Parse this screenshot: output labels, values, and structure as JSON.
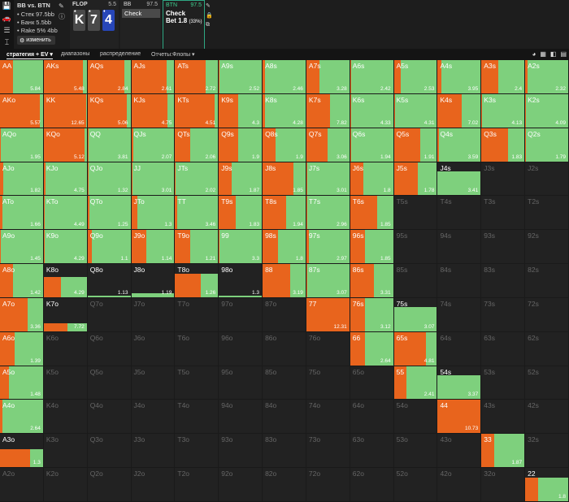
{
  "colors": {
    "check": "#7ed07d",
    "bet": "#e8641d",
    "empty": "#222222",
    "accent": "#2ea883"
  },
  "sidebar_icons": [
    "save-icon",
    "car-icon",
    "layers-icon",
    "cursor-icon"
  ],
  "info": {
    "matchup": "BB vs. BTN",
    "stack": "• Стек 97.5bb",
    "bank": "• Банк 5.5bb",
    "rake": "• Rake 5% 4bb",
    "edit_label": "изменить"
  },
  "flop": {
    "label": "FLOP",
    "pot": "5.5",
    "cards": [
      {
        "rank": "K",
        "suit": "♠",
        "color": "#4a4a4a"
      },
      {
        "rank": "7",
        "suit": "♠",
        "color": "#4a4a4a"
      },
      {
        "rank": "4",
        "suit": "♦",
        "color": "#2746b8"
      }
    ]
  },
  "bb": {
    "label": "BB",
    "pot": "97.5",
    "action": "Check"
  },
  "btn": {
    "label": "BTN",
    "pot": "97.5",
    "action1": "Check",
    "action2": "Bet 1.8",
    "action2_pct": "(33%)"
  },
  "tabs": [
    {
      "label": "стратегия + EV",
      "active": true,
      "caret": true
    },
    {
      "label": "диапазоны",
      "active": false,
      "caret": false
    },
    {
      "label": "распределение",
      "active": false,
      "caret": false
    },
    {
      "label": "Отчеты:Флопы",
      "active": false,
      "caret": true
    }
  ],
  "grid": {
    "rows": [
      [
        [
          "AA",
          0.3,
          "5.84"
        ],
        [
          "AKs",
          0.92,
          "5.48"
        ],
        [
          "AQs",
          0.85,
          "2.84"
        ],
        [
          "AJs",
          0.83,
          "2.61"
        ],
        [
          "ATs",
          0.72,
          "2.72"
        ],
        [
          "A9s",
          0.02,
          "2.52"
        ],
        [
          "A8s",
          0.05,
          "2.46"
        ],
        [
          "A7s",
          0.3,
          "3.28"
        ],
        [
          "A6s",
          0.02,
          "2.42"
        ],
        [
          "A5s",
          0.15,
          "2.53"
        ],
        [
          "A4s",
          0.08,
          "3.95"
        ],
        [
          "A3s",
          0.4,
          "2.4"
        ],
        [
          "A2s",
          0.05,
          "2.32"
        ]
      ],
      [
        [
          "AKo",
          0.92,
          "5.57"
        ],
        [
          "KK",
          0.98,
          "12.65"
        ],
        [
          "KQs",
          0.92,
          "5.06"
        ],
        [
          "KJs",
          0.85,
          "4.75"
        ],
        [
          "KTs",
          0.92,
          "4.51"
        ],
        [
          "K9s",
          0.45,
          "4.3"
        ],
        [
          "K8s",
          0.05,
          "4.28"
        ],
        [
          "K7s",
          0.55,
          "7.82"
        ],
        [
          "K6s",
          0.02,
          "4.33"
        ],
        [
          "K5s",
          0.02,
          "4.31"
        ],
        [
          "K4s",
          0.55,
          "7.02"
        ],
        [
          "K3s",
          0.02,
          "4.13"
        ],
        [
          "K2s",
          0.02,
          "4.09"
        ]
      ],
      [
        [
          "AQo",
          0.02,
          "1.95"
        ],
        [
          "KQo",
          0.95,
          "5.12"
        ],
        [
          "QQ",
          0.02,
          "3.81"
        ],
        [
          "QJs",
          0.05,
          "2.07"
        ],
        [
          "QTs",
          0.35,
          "2.06"
        ],
        [
          "Q9s",
          0.45,
          "1.9"
        ],
        [
          "Q8s",
          0.3,
          "1.9"
        ],
        [
          "Q7s",
          0.5,
          "3.06"
        ],
        [
          "Q6s",
          0.02,
          "1.94"
        ],
        [
          "Q5s",
          0.62,
          "1.91"
        ],
        [
          "Q4s",
          0.02,
          "3.59"
        ],
        [
          "Q3s",
          0.62,
          "1.83"
        ],
        [
          "Q2s",
          0.02,
          "1.79"
        ]
      ],
      [
        [
          "AJo",
          0.08,
          "1.82"
        ],
        [
          "KJo",
          0.05,
          "4.75"
        ],
        [
          "QJo",
          0.02,
          "1.32"
        ],
        [
          "JJ",
          0.02,
          "3.01"
        ],
        [
          "JTs",
          0.02,
          "2.02"
        ],
        [
          "J9s",
          0.3,
          "1.87"
        ],
        [
          "J8s",
          0.72,
          "1.85"
        ],
        [
          "J7s",
          0.02,
          "3.01"
        ],
        [
          "J6s",
          0.3,
          "1.8"
        ],
        [
          "J5s",
          0.55,
          "1.78"
        ],
        [
          "J4s",
          0.0,
          "3.41",
          0.72
        ],
        [
          "J3s",
          -1,
          ""
        ],
        [
          "J2s",
          -1,
          ""
        ]
      ],
      [
        [
          "ATo",
          0.05,
          "1.66"
        ],
        [
          "KTo",
          0.02,
          "4.49"
        ],
        [
          "QTo",
          0.05,
          "1.25"
        ],
        [
          "JTo",
          0.15,
          "1.3"
        ],
        [
          "TT",
          0.05,
          "3.46"
        ],
        [
          "T9s",
          0.4,
          "1.83"
        ],
        [
          "T8s",
          0.55,
          "1.94"
        ],
        [
          "T7s",
          0.02,
          "2.96"
        ],
        [
          "T6s",
          0.62,
          "1.85"
        ],
        [
          "T5s",
          -1,
          ""
        ],
        [
          "T4s",
          -1,
          ""
        ],
        [
          "T3s",
          -1,
          ""
        ],
        [
          "T2s",
          -1,
          ""
        ]
      ],
      [
        [
          "A9o",
          0.02,
          "1.45"
        ],
        [
          "K9o",
          0.02,
          "4.29"
        ],
        [
          "Q9o",
          0.1,
          "1.1"
        ],
        [
          "J9o",
          0.35,
          "1.14"
        ],
        [
          "T9o",
          0.35,
          "1.21"
        ],
        [
          "99",
          0.02,
          "3.3"
        ],
        [
          "98s",
          0.35,
          "1.8"
        ],
        [
          "97s",
          0.05,
          "2.97"
        ],
        [
          "96s",
          0.35,
          "1.85"
        ],
        [
          "95s",
          -1,
          ""
        ],
        [
          "94s",
          -1,
          ""
        ],
        [
          "93s",
          -1,
          ""
        ],
        [
          "92s",
          -1,
          ""
        ]
      ],
      [
        [
          "A8o",
          0.3,
          "1.42"
        ],
        [
          "K8o",
          0.4,
          "4.29",
          0.62
        ],
        [
          "Q8o",
          0.0,
          "1.13",
          0.05
        ],
        [
          "J8o",
          0.0,
          "1.19",
          0.12
        ],
        [
          "T8o",
          0.6,
          "1.26",
          0.7
        ],
        [
          "98o",
          0.0,
          "1.3",
          0.05
        ],
        [
          "88",
          0.65,
          "3.19"
        ],
        [
          "87s",
          0.02,
          "3.07"
        ],
        [
          "86s",
          0.55,
          "3.31"
        ],
        [
          "85s",
          -1,
          ""
        ],
        [
          "84s",
          -1,
          ""
        ],
        [
          "83s",
          -1,
          ""
        ],
        [
          "82s",
          -1,
          ""
        ]
      ],
      [
        [
          "A7o",
          0.65,
          "3.36"
        ],
        [
          "K7o",
          0.55,
          "7.72",
          0.25
        ],
        [
          "Q7o",
          -1,
          ""
        ],
        [
          "J7o",
          -1,
          ""
        ],
        [
          "T7o",
          -1,
          ""
        ],
        [
          "97o",
          -1,
          ""
        ],
        [
          "87o",
          -1,
          ""
        ],
        [
          "77",
          1.0,
          "12.31"
        ],
        [
          "76s",
          0.35,
          "3.12"
        ],
        [
          "75s",
          0.0,
          "3.07",
          0.72
        ],
        [
          "74s",
          -1,
          ""
        ],
        [
          "73s",
          -1,
          ""
        ],
        [
          "72s",
          -1,
          ""
        ]
      ],
      [
        [
          "A6o",
          0.35,
          "1.39"
        ],
        [
          "K6o",
          -1,
          ""
        ],
        [
          "Q6o",
          -1,
          ""
        ],
        [
          "J6o",
          -1,
          ""
        ],
        [
          "T6o",
          -1,
          ""
        ],
        [
          "96o",
          -1,
          ""
        ],
        [
          "86o",
          -1,
          ""
        ],
        [
          "76o",
          -1,
          ""
        ],
        [
          "66",
          0.35,
          "2.64"
        ],
        [
          "65s",
          0.75,
          "4.81"
        ],
        [
          "64s",
          -1,
          ""
        ],
        [
          "63s",
          -1,
          ""
        ],
        [
          "62s",
          -1,
          ""
        ]
      ],
      [
        [
          "A5o",
          0.2,
          "1.48"
        ],
        [
          "K5o",
          -1,
          ""
        ],
        [
          "Q5o",
          -1,
          ""
        ],
        [
          "J5o",
          -1,
          ""
        ],
        [
          "T5o",
          -1,
          ""
        ],
        [
          "95o",
          -1,
          ""
        ],
        [
          "85o",
          -1,
          ""
        ],
        [
          "75o",
          -1,
          ""
        ],
        [
          "65o",
          -1,
          ""
        ],
        [
          "55",
          0.3,
          "2.41"
        ],
        [
          "54s",
          0.0,
          "3.37",
          0.72
        ],
        [
          "53s",
          -1,
          ""
        ],
        [
          "52s",
          -1,
          ""
        ]
      ],
      [
        [
          "A4o",
          0.05,
          "2.64"
        ],
        [
          "K4o",
          -1,
          ""
        ],
        [
          "Q4o",
          -1,
          ""
        ],
        [
          "J4o",
          -1,
          ""
        ],
        [
          "T4o",
          -1,
          ""
        ],
        [
          "94o",
          -1,
          ""
        ],
        [
          "84o",
          -1,
          ""
        ],
        [
          "74o",
          -1,
          ""
        ],
        [
          "64o",
          -1,
          ""
        ],
        [
          "54o",
          -1,
          ""
        ],
        [
          "44",
          1.0,
          "10.73"
        ],
        [
          "43s",
          -1,
          ""
        ],
        [
          "42s",
          -1,
          ""
        ]
      ],
      [
        [
          "A3o",
          0.7,
          "1.3",
          0.55
        ],
        [
          "K3o",
          -1,
          ""
        ],
        [
          "Q3o",
          -1,
          ""
        ],
        [
          "J3o",
          -1,
          ""
        ],
        [
          "T3o",
          -1,
          ""
        ],
        [
          "93o",
          -1,
          ""
        ],
        [
          "83o",
          -1,
          ""
        ],
        [
          "73o",
          -1,
          ""
        ],
        [
          "63o",
          -1,
          ""
        ],
        [
          "53o",
          -1,
          ""
        ],
        [
          "43o",
          -1,
          ""
        ],
        [
          "33",
          0.3,
          "1.87"
        ],
        [
          "32s",
          -1,
          ""
        ]
      ],
      [
        [
          "A2o",
          -1,
          ""
        ],
        [
          "K2o",
          -1,
          ""
        ],
        [
          "Q2o",
          -1,
          ""
        ],
        [
          "J2o",
          -1,
          ""
        ],
        [
          "T2o",
          -1,
          ""
        ],
        [
          "92o",
          -1,
          ""
        ],
        [
          "82o",
          -1,
          ""
        ],
        [
          "72o",
          -1,
          ""
        ],
        [
          "62o",
          -1,
          ""
        ],
        [
          "52o",
          -1,
          ""
        ],
        [
          "42o",
          -1,
          ""
        ],
        [
          "32o",
          -1,
          ""
        ],
        [
          "22",
          0.3,
          "1.8",
          0.72
        ]
      ]
    ]
  }
}
